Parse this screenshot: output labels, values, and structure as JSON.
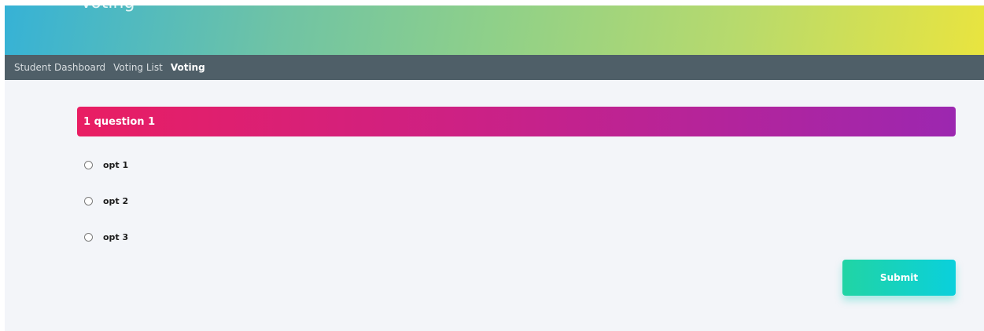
{
  "header": {
    "title": "Voting"
  },
  "nav": {
    "items": [
      {
        "label": "Student Dashboard"
      },
      {
        "label": "Voting List"
      },
      {
        "label": "Voting"
      }
    ]
  },
  "question": {
    "title": "1 question 1",
    "options": [
      {
        "label": "opt 1",
        "selected": false
      },
      {
        "label": "opt 2",
        "selected": false
      },
      {
        "label": "opt 3",
        "selected": false
      }
    ]
  },
  "actions": {
    "submit_label": "Submit"
  },
  "colors": {
    "nav_bg": "#4f5f68",
    "question_gradient_start": "#e91e63",
    "question_gradient_end": "#9c27b0",
    "submit_gradient_start": "#21d4a4",
    "submit_gradient_end": "#0ad0dc"
  }
}
